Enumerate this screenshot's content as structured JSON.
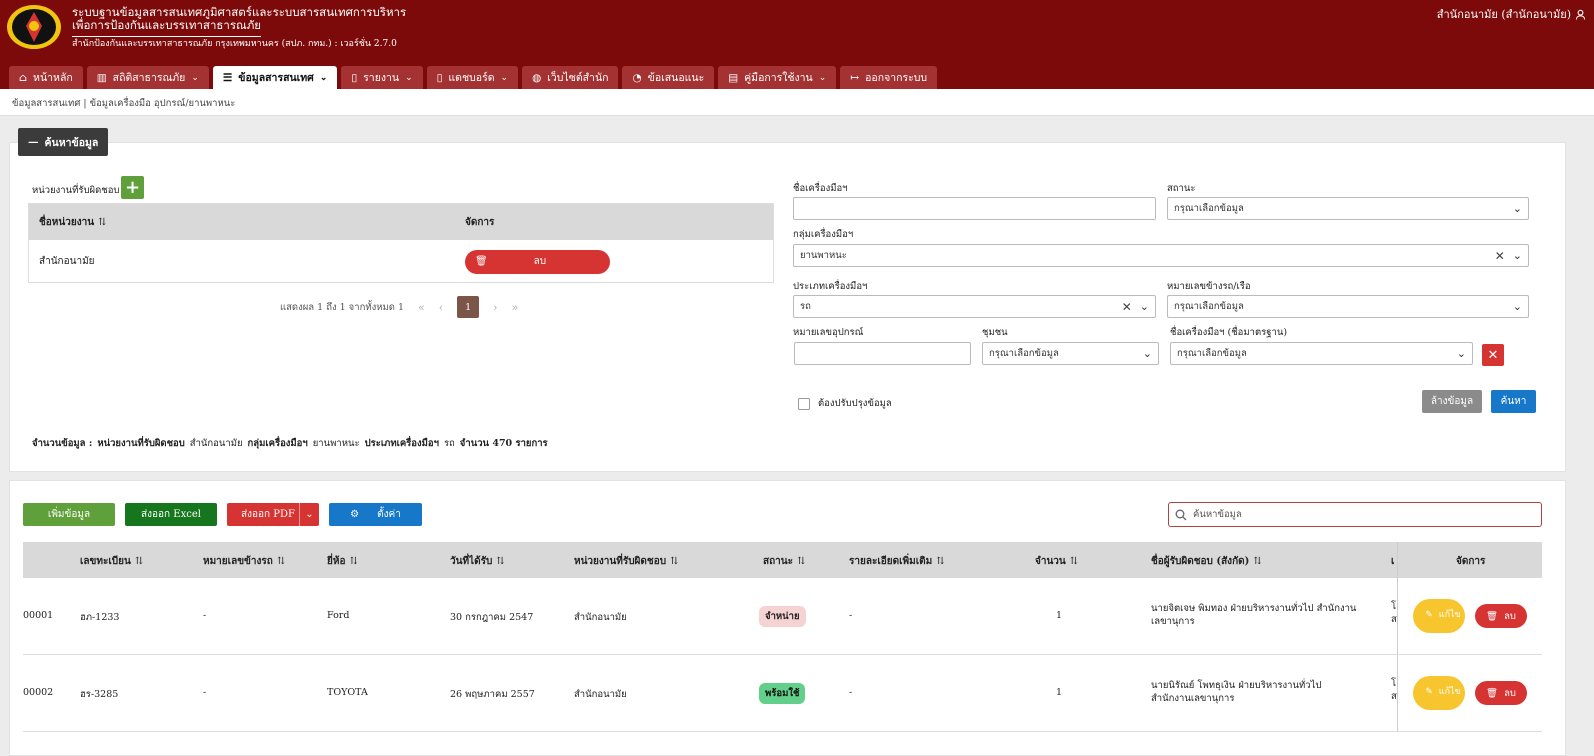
{
  "header": {
    "title_line1": "ระบบฐานข้อมูลสารสนเทศภูมิศาสตร์และระบบสารสนเทศการบริหาร",
    "title_line2": "เพื่อการป้องกันและบรรเทาสาธารณภัย",
    "subtitle": "สำนักป้องกันและบรรเทาสาธารณภัย กรุงเทพมหานคร (สปภ. กทม.) : เวอร์ชั่น 2.7.0",
    "user": "สำนักอนามัย (สำนักอนามัย)"
  },
  "tabs": [
    {
      "label": "หน้าหลัก",
      "icon": "home-icon",
      "dropdown": false
    },
    {
      "label": "สถิติสาธารณภัย",
      "icon": "chart-icon",
      "dropdown": true
    },
    {
      "label": "ข้อมูลสารสนเทศ",
      "icon": "list-icon",
      "dropdown": true,
      "active": true
    },
    {
      "label": "รายงาน",
      "icon": "document-icon",
      "dropdown": true
    },
    {
      "label": "แดชบอร์ด",
      "icon": "document-icon",
      "dropdown": true
    },
    {
      "label": "เว็บไซต์สำนัก",
      "icon": "globe-icon",
      "dropdown": false
    },
    {
      "label": "ข้อเสนอแนะ",
      "icon": "comment-icon",
      "dropdown": false
    },
    {
      "label": "คู่มือการใช้งาน",
      "icon": "book-icon",
      "dropdown": true
    },
    {
      "label": "ออกจากระบบ",
      "icon": "logout-icon",
      "dropdown": false
    }
  ],
  "breadcrumb": "ข้อมูลสารสนเทศ | ข้อมูลเครื่องมือ อุปกรณ์/ยานพาหนะ",
  "search": {
    "toggle_label": "ค้นหาข้อมูล",
    "unit_label": "หน่วยงานที่รับผิดชอบ",
    "unit_table": {
      "col_name": "ชื่อหน่วยงาน",
      "col_action": "จัดการ",
      "rows": [
        {
          "name": "สำนักอนามัย",
          "delete_label": "ลบ"
        }
      ]
    },
    "pager": {
      "info": "แสดงผล 1 ถึง 1 จากทั้งหมด 1",
      "first": "«",
      "prev": "‹",
      "current": "1",
      "next": "›",
      "last": "»"
    },
    "tool_name_label": "ชื่อเครื่องมือฯ",
    "tool_name_value": "",
    "status_label": "สถานะ",
    "status_value": "กรุณาเลือกข้อมูล",
    "group_label": "กลุ่มเครื่องมือฯ",
    "group_value": "ยานพาหนะ",
    "type_label": "ประเภทเครื่องมือฯ",
    "type_value": "รถ",
    "plate_label": "หมายเลขข้างรถ/เรือ",
    "plate_value": "กรุณาเลือกข้อมูล",
    "equip_no_label": "หมายเลขอุปกรณ์",
    "equip_no_value": "",
    "community_label": "ชุมชน",
    "community_value": "กรุณาเลือกข้อมูล",
    "std_name_label": "ชื่อเครื่องมือฯ (ชื่อมาตรฐาน)",
    "std_name_value": "กรุณาเลือกข้อมูล",
    "needs_update_label": "ต้องปรับปรุงข้อมูล",
    "clear_label": "ล้างข้อมูล",
    "search_label": "ค้นหา"
  },
  "summary": {
    "prefix": "จำนวนข้อมูล :",
    "k1": "หน่วยงานที่รับผิดชอบ",
    "v1": "สำนักอนามัย",
    "k2": "กลุ่มเครื่องมือฯ",
    "v2": "ยานพาหนะ",
    "k3": "ประเภทเครื่องมือฯ",
    "v3": "รถ",
    "count": "จำนวน 470 รายการ"
  },
  "actions": {
    "add": "เพิ่มข้อมูล",
    "excel": "ส่งออก Excel",
    "pdf": "ส่งออก PDF",
    "settings": "ตั้งค่า",
    "search_placeholder": "ค้นหาข้อมูล"
  },
  "table": {
    "headers": {
      "reg_no": "เลขทะเบียน",
      "side_no": "หมายเลขข้างรถ",
      "brand": "ยี่ห้อ",
      "received": "วันที่ได้รับ",
      "unit": "หน่วยงานที่รับผิดชอบ",
      "status": "สถานะ",
      "details": "รายละเอียดเพิ่มเติม",
      "qty": "จำนวน",
      "owner": "ชื่อผู้รับผิดชอบ (สังกัด)",
      "next": "เ",
      "manage": "จัดการ"
    },
    "rows": [
      {
        "id": "00001",
        "reg_no": "ฮภ-1233",
        "side_no": "-",
        "brand": "Ford",
        "received": "30 กรกฎาคม 2547",
        "unit": "สำนักอนามัย",
        "status": "จำหน่าย",
        "details": "-",
        "qty": "1",
        "owner": "นายจิตเจษ พิมทอง ฝ่ายบริหารงานทั่วไป สำนักงานเลขานุการ",
        "next": "โ",
        "next2": "ส",
        "edit": "แก้ไข",
        "delete": "ลบ"
      },
      {
        "id": "00002",
        "reg_no": "ฮร-3285",
        "side_no": "-",
        "brand": "TOYOTA",
        "received": "26 พฤษภาคม 2557",
        "unit": "สำนักอนามัย",
        "status": "พร้อมใช้",
        "details": "-",
        "qty": "1",
        "owner": "นายนิรัณย์ โพทธุเงิน ฝ่ายบริหารงานทั่วไป สำนักงานเลขานุการ",
        "next": "โ",
        "next2": "ส",
        "edit": "แก้ไข",
        "delete": "ลบ"
      }
    ]
  },
  "colors": {
    "brand": "#7d0a0a",
    "primary": "#1778c9",
    "danger": "#d63333",
    "success": "#5fa03b",
    "warning": "#f7c52d"
  }
}
